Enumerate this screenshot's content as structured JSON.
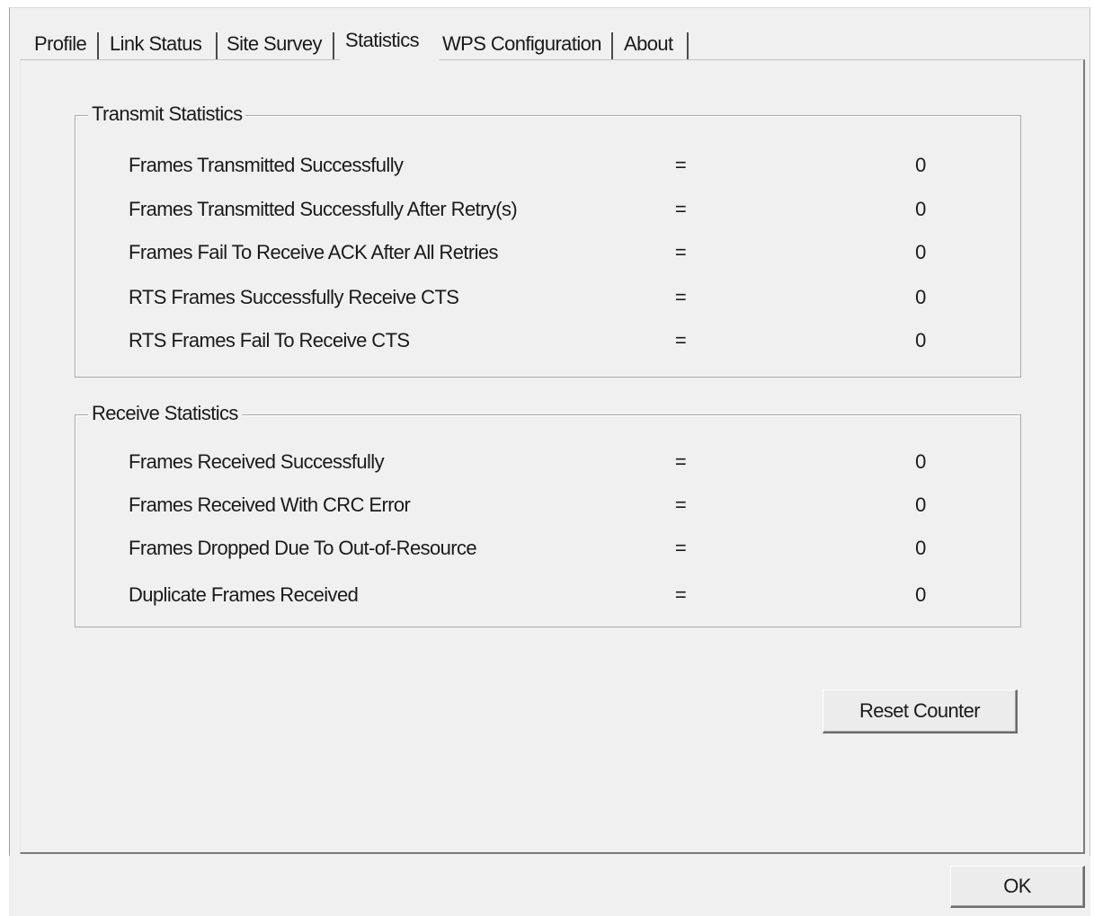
{
  "tabs": [
    {
      "label": "Profile"
    },
    {
      "label": "Link Status"
    },
    {
      "label": "Site Survey"
    },
    {
      "label": "Statistics"
    },
    {
      "label": "WPS Configuration"
    },
    {
      "label": "About"
    }
  ],
  "active_tab": "Statistics",
  "transmit": {
    "title": "Transmit Statistics",
    "rows": [
      {
        "label": "Frames Transmitted Successfully",
        "eq": "=",
        "value": "0"
      },
      {
        "label": "Frames Transmitted Successfully After Retry(s)",
        "eq": "=",
        "value": "0"
      },
      {
        "label": "Frames Fail To Receive ACK After All Retries",
        "eq": "=",
        "value": "0"
      },
      {
        "label": "RTS Frames Successfully Receive CTS",
        "eq": "=",
        "value": "0"
      },
      {
        "label": "RTS Frames Fail To Receive CTS",
        "eq": "=",
        "value": "0"
      }
    ]
  },
  "receive": {
    "title": "Receive Statistics",
    "rows": [
      {
        "label": "Frames Received Successfully",
        "eq": "=",
        "value": "0"
      },
      {
        "label": "Frames Received With CRC Error",
        "eq": "=",
        "value": "0"
      },
      {
        "label": "Frames Dropped Due To Out-of-Resource",
        "eq": "=",
        "value": "0"
      },
      {
        "label": "Duplicate Frames Received",
        "eq": "=",
        "value": "0"
      }
    ]
  },
  "buttons": {
    "reset": "Reset Counter",
    "ok": "OK"
  }
}
